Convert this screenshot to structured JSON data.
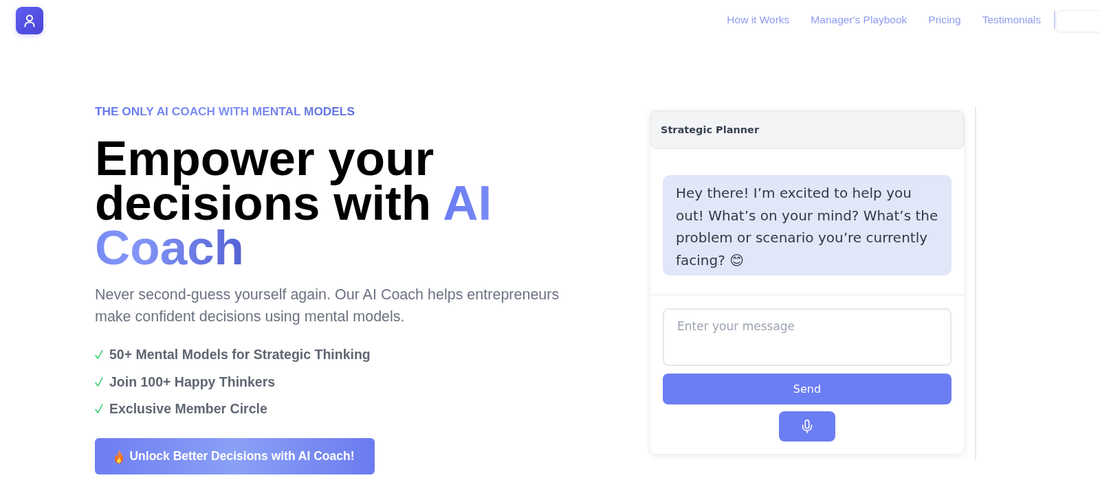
{
  "header": {
    "nav_links": [
      "How it Works",
      "Manager's Playbook",
      "Pricing",
      "Testimonials"
    ]
  },
  "hero": {
    "eyebrow": "THE ONLY AI COACH WITH MENTAL MODELS",
    "heading": "Empower your decisions with",
    "heading_highlight": "AI Coach",
    "subheading": "Never second-guess yourself again. Our AI Coach helps entrepreneurs make confident decisions using mental models.",
    "features": [
      "50+ Mental Models for Strategic Thinking",
      "Join 100+ Happy Thinkers",
      "Exclusive Member Circle"
    ],
    "cta_button": "Unlock Better Decisions with AI Coach!"
  },
  "chat": {
    "title": "Strategic Planner",
    "messages": [
      "Hey there! I’m excited to help you out! What’s on your mind? What’s the problem or scenario you’re currently facing? 😊"
    ],
    "input": {
      "placeholder": "Enter your message"
    },
    "send_button": "Send"
  }
}
